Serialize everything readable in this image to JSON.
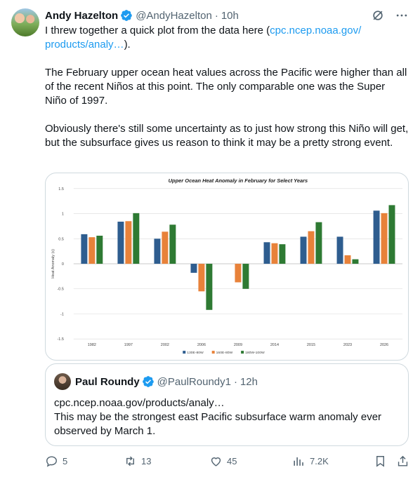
{
  "author": {
    "name": "Andy Hazelton",
    "handle": "@AndyHazelton",
    "sep": "·",
    "time": "10h"
  },
  "tweet": {
    "line1_text": "I threw together a quick plot from the data here (",
    "line1_link": "cpc.ncep.noaa.gov/",
    "line1_link2": "products/analy…",
    "line1_end": ").",
    "para2": "The February upper ocean heat values across the Pacific were higher than all of the recent Niños at this point. The only comparable one was the Super Niño of 1997.",
    "para3": "Obviously there's still some uncertainty as to just how strong this Niño will get, but the subsurface gives us reason to think it may be a pretty strong event."
  },
  "chart_data": {
    "type": "bar",
    "title": "Upper Ocean Heat Anomaly in February for Select Years",
    "ylabel": "Heat Anomaly (c)",
    "xlabel": "",
    "ylim": [
      -1.5,
      1.5
    ],
    "yticks": [
      "1.5",
      "1",
      "0.5",
      "0",
      "-0.5",
      "-1",
      "-1.5"
    ],
    "categories": [
      "1982",
      "1997",
      "2002",
      "2006",
      "2009",
      "2014",
      "2015",
      "2023",
      "2026"
    ],
    "series": [
      {
        "name": "130E-80W",
        "color": "#2e5d8f",
        "values": [
          0.59,
          0.84,
          0.5,
          -0.18,
          null,
          0.43,
          0.54,
          0.54,
          1.06
        ]
      },
      {
        "name": "160E-80W",
        "color": "#e8823a",
        "values": [
          0.53,
          0.85,
          0.64,
          -0.55,
          -0.37,
          0.41,
          0.65,
          0.17,
          1.01
        ]
      },
      {
        "name": "180W-100W",
        "color": "#2e7a33",
        "values": [
          0.56,
          1.01,
          0.78,
          -0.92,
          -0.5,
          0.39,
          0.83,
          0.09,
          1.17
        ]
      }
    ],
    "grid": true,
    "legend": "bottom"
  },
  "quote": {
    "name": "Paul Roundy",
    "handle": "@PaulRoundy1",
    "sep": "·",
    "time": "12h",
    "line1": "cpc.ncep.noaa.gov/products/analy…",
    "line2": "This may be the strongest east Pacific subsurface warm anomaly ever observed by March 1."
  },
  "actions": {
    "replies": "5",
    "reposts": "13",
    "likes": "45",
    "views": "7.2K"
  },
  "colors": {
    "link": "#1d9bf0",
    "verified": "#1d9bf0",
    "muted": "#536471",
    "border": "#cfd9de"
  }
}
